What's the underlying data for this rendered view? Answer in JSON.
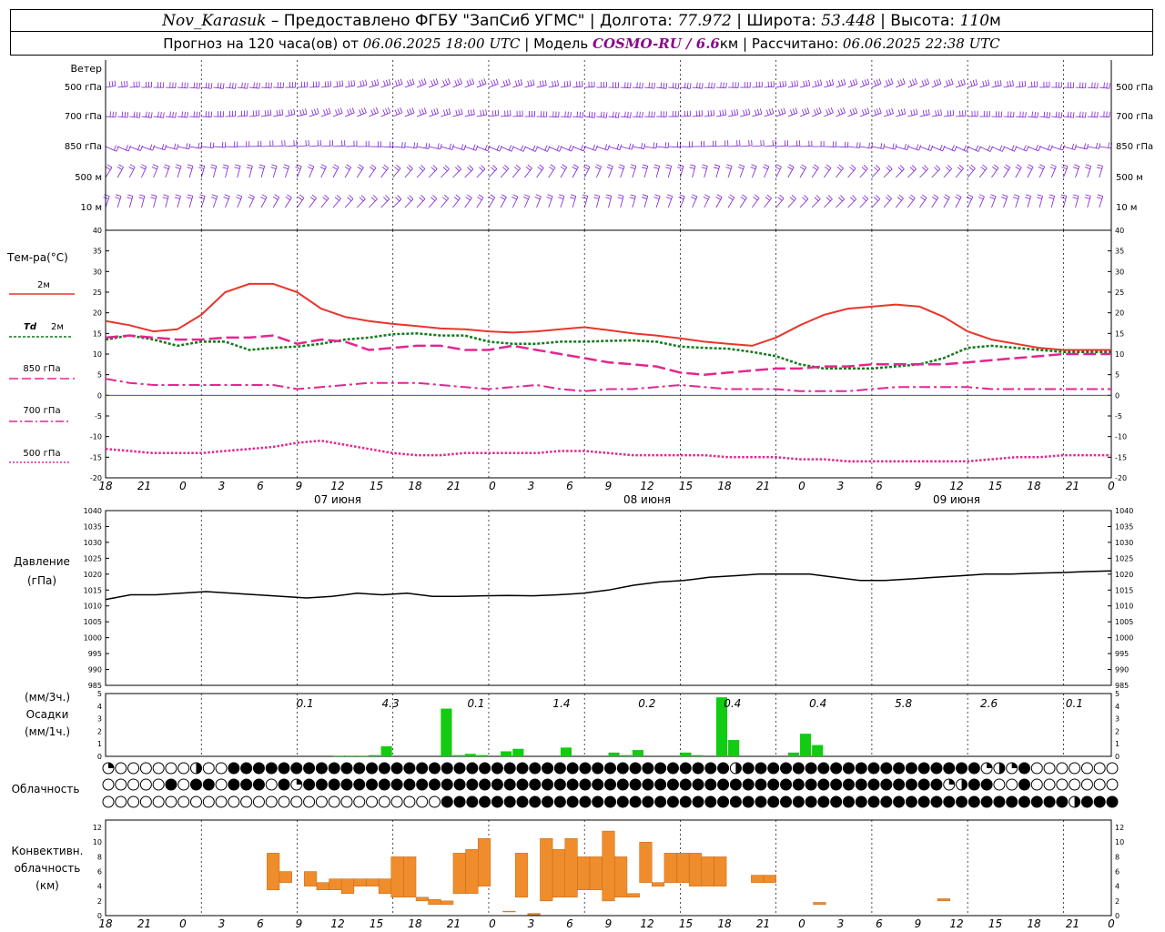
{
  "header": {
    "station": "Nov_Karasuk",
    "dash": " – ",
    "provided_by": "Предоставлено ФГБУ \"ЗапСиб УГМС\"",
    "sep": " | ",
    "lon_label": "Долгота: ",
    "lon_value": "77.972",
    "lat_label": "Широта: ",
    "lat_value": "53.448",
    "alt_label": "Высота: ",
    "alt_value": "110",
    "alt_unit": "м"
  },
  "subheader": {
    "forecast_label": "Прогноз на 120 часа(ов) от ",
    "forecast_time": "06.06.2025 18:00 UTC",
    "model_label": " | Модель ",
    "model_name": "COSMO-RU / 6.6",
    "model_unit": "км",
    "calc_label": " | Рассчитано: ",
    "calc_time": "06.06.2025 22:38 UTC"
  },
  "wind": {
    "title": "Ветер",
    "levels": [
      "500 гПа",
      "700 гПа",
      "850 гПа",
      "500 м",
      "10 м"
    ],
    "color": "#7a1fd6"
  },
  "x_axis": {
    "ticks": [
      "18",
      "21",
      "0",
      "3",
      "6",
      "9",
      "12",
      "15",
      "18",
      "21",
      "0",
      "3",
      "6",
      "9",
      "12",
      "15",
      "18",
      "21",
      "0",
      "3",
      "6",
      "9",
      "12",
      "15",
      "18",
      "21",
      "0"
    ],
    "dates": [
      "07 июня",
      "08 июня",
      "09 июня"
    ]
  },
  "legend": {
    "temp_title": "Тем-ра(°C)",
    "t2m": "2м",
    "td_symbol": "Td",
    "td_level": "2м",
    "t850": "850 гПа",
    "t700": "700 гПа",
    "t500": "500 гПа",
    "colors": {
      "t2m": "#e8352c",
      "td": "#11791b",
      "t850": "#e3268f",
      "t700": "#e3268f",
      "t500": "#e3268f"
    }
  },
  "pressure_panel": {
    "label1": "Давление",
    "label2": "(гПа)"
  },
  "precip_panel": {
    "label1": "(мм/3ч.)",
    "label2": "Осадки",
    "label3": "(мм/1ч.)",
    "bar_color": "#11cc11"
  },
  "cloud_panel": {
    "label": "Облачность"
  },
  "conv_panel": {
    "label1": "Конвективн.",
    "label2": "облачность",
    "label3": "(км)",
    "bar_color": "#ef8c2c"
  },
  "chart_data": [
    {
      "type": "line",
      "title": "Тем-ра(°C)",
      "x": [
        0,
        3,
        6,
        9,
        12,
        15,
        18,
        21,
        24,
        27,
        30,
        33,
        36,
        39,
        42,
        45,
        48,
        51,
        54,
        57,
        60,
        63,
        66,
        69,
        72,
        75,
        78,
        81,
        84,
        87,
        90,
        93,
        96,
        99,
        102,
        105,
        108,
        111,
        114,
        117,
        120,
        123,
        126
      ],
      "ylim": [
        -20,
        40
      ],
      "yticks": [
        40,
        35,
        30,
        25,
        20,
        15,
        10,
        5,
        0,
        -5,
        -10,
        -15,
        -20
      ],
      "series": [
        {
          "name": "2м",
          "values": [
            18,
            17,
            15.5,
            16,
            19.5,
            25,
            27,
            27,
            25,
            21,
            19,
            18,
            17.3,
            16.8,
            16.2,
            16,
            15.5,
            15.2,
            15.5,
            16,
            16.5,
            15.8,
            15,
            14.5,
            13.8,
            13,
            12.5,
            12,
            14,
            17,
            19.5,
            21,
            21.5,
            22,
            21.5,
            19,
            15.5,
            13.5,
            12.5,
            11.5,
            11,
            11,
            11
          ]
        },
        {
          "name": "Td 2м",
          "values": [
            13.5,
            14.5,
            13.5,
            12,
            13,
            13,
            11,
            11.5,
            11.8,
            12.5,
            13.5,
            14,
            14.8,
            15,
            14.5,
            14.5,
            13,
            12.5,
            12.5,
            13,
            13,
            13.2,
            13.3,
            13,
            11.8,
            11.5,
            11.3,
            10.5,
            9.5,
            7.5,
            6.5,
            6.5,
            6.5,
            7,
            7.5,
            9,
            11.5,
            12,
            11.5,
            11,
            10.5,
            10.5,
            10.5
          ]
        },
        {
          "name": "850 гПа",
          "values": [
            14,
            14.5,
            14,
            13.5,
            13.5,
            14,
            14,
            14.5,
            12.5,
            13.5,
            13,
            11,
            11.5,
            12,
            12,
            11,
            11,
            12,
            11,
            10,
            9,
            8,
            7.5,
            7,
            5.5,
            5,
            5.5,
            6,
            6.5,
            6.5,
            7,
            7,
            7.5,
            7.5,
            7.5,
            7.5,
            8,
            8.5,
            9,
            9.5,
            10,
            10,
            10
          ]
        },
        {
          "name": "700 гПа",
          "values": [
            4,
            3,
            2.5,
            2.5,
            2.5,
            2.5,
            2.5,
            2.5,
            1.5,
            2,
            2.5,
            3,
            3,
            3,
            2.5,
            2,
            1.5,
            2,
            2.5,
            1.5,
            1,
            1.5,
            1.5,
            2,
            2.5,
            2,
            1.5,
            1.5,
            1.5,
            1,
            1,
            1,
            1.5,
            2,
            2,
            2,
            2,
            1.5,
            1.5,
            1.5,
            1.5,
            1.5,
            1.5
          ]
        },
        {
          "name": "500 гПа",
          "values": [
            -13,
            -13.5,
            -14,
            -14,
            -14,
            -13.5,
            -13,
            -12.5,
            -11.5,
            -11,
            -12,
            -13,
            -14,
            -14.5,
            -14.5,
            -14,
            -14,
            -14,
            -14,
            -13.5,
            -13.5,
            -14,
            -14.5,
            -14.5,
            -14.5,
            -14.5,
            -15,
            -15,
            -15,
            -15.5,
            -15.5,
            -16,
            -16,
            -16,
            -16,
            -16,
            -16,
            -15.5,
            -15,
            -15,
            -14.5,
            -14.5,
            -14.5
          ]
        }
      ]
    },
    {
      "type": "line",
      "title": "Давление (гПа)",
      "ylim": [
        985,
        1040
      ],
      "yticks": [
        1040,
        1035,
        1030,
        1025,
        1020,
        1015,
        1010,
        1005,
        1000,
        995,
        990,
        985
      ],
      "series": [
        {
          "name": "Давление",
          "color": "#000000",
          "x": [
            0,
            3,
            6,
            9,
            12,
            15,
            18,
            21,
            24,
            27,
            30,
            33,
            36,
            39,
            42,
            45,
            48,
            51,
            54,
            57,
            60,
            63,
            66,
            69,
            72,
            75,
            78,
            81,
            84,
            87,
            90,
            93,
            96,
            99,
            102,
            105,
            108,
            111,
            114,
            117,
            120
          ],
          "values": [
            1012,
            1013.5,
            1013.5,
            1014,
            1014.5,
            1014,
            1013.5,
            1013,
            1012.5,
            1013,
            1014,
            1013.5,
            1014,
            1013,
            1013,
            1013.2,
            1013.3,
            1013.2,
            1013.5,
            1014,
            1015,
            1016.5,
            1017.5,
            1018,
            1019,
            1019.5,
            1020,
            1020,
            1020,
            1019,
            1018,
            1018,
            1018.5,
            1019,
            1019.5,
            1020,
            1020,
            1020.3,
            1020.5,
            1020.8,
            1021
          ]
        }
      ]
    },
    {
      "type": "bar",
      "title": "Осадки (мм/1ч.)",
      "ylim": [
        0,
        5
      ],
      "yticks": [
        5,
        4,
        3,
        2,
        1,
        0
      ],
      "three_hour_totals": {
        "x": [
          12,
          18,
          24,
          30,
          36,
          42,
          48,
          54,
          60,
          66,
          72
        ],
        "labels": [
          "0.1",
          "4.3",
          "0.1",
          "1.4",
          "0.2",
          "0.4",
          "0.4",
          "5.8",
          "2.6",
          "0.1",
          ""
        ]
      },
      "hourly": {
        "x": [
          19,
          20,
          21,
          22,
          23,
          28,
          29,
          30,
          31,
          33,
          34,
          38,
          42,
          43,
          44,
          48,
          49,
          51,
          52,
          57,
          58,
          59
        ],
        "values": [
          0.05,
          0.05,
          0.05,
          0.1,
          0.8,
          3.8,
          0.1,
          0.2,
          0.1,
          0.4,
          0.6,
          0.7,
          0.3,
          0.1,
          0.5,
          0.3,
          0.1,
          4.7,
          1.3,
          0.3,
          1.8,
          0.9
        ]
      }
    },
    {
      "type": "table",
      "title": "Облачность",
      "rows": [
        "qoooooofoohhhhhhhhhhhhhhhhhhhhhhhhhhhhhhhhhhhhhhhhfhhhhhhhhhhhhhhhhhhhqfqhooooooooooooooooooooooooooooooooooooooooo",
        "ooooohohhohhhohthhhhhhhhhhhhhhhhhhhhhhhhhhhhhhhhhhhhhhhhhhhhhhhhhhhtfhhoohooooooooooooooooooooooooooooooooooooooooo",
        "ooooooooooooooooooooooooooohhhhhhhhhhhhhhhhhhhhhhhhhhhhhhhhhhhhhhhhhhhhhhhhhhfhhhhhhhhhhhhhhhhhhhhhhhhhoooooooooooooo"
      ]
    },
    {
      "type": "bar",
      "title": "Конвективн. облачность (км)",
      "ylim": [
        0,
        13
      ],
      "yticks": [
        12,
        10,
        8,
        6,
        4,
        2,
        0
      ],
      "segments": [
        {
          "x": 13,
          "bottom": 3.5,
          "top": 8.5
        },
        {
          "x": 14,
          "bottom": 4.5,
          "top": 6
        },
        {
          "x": 16,
          "bottom": 4,
          "top": 6
        },
        {
          "x": 17,
          "bottom": 3.5,
          "top": 4.5
        },
        {
          "x": 18,
          "bottom": 3.5,
          "top": 5
        },
        {
          "x": 19,
          "bottom": 3,
          "top": 5
        },
        {
          "x": 20,
          "bottom": 4,
          "top": 5
        },
        {
          "x": 21,
          "bottom": 4,
          "top": 5
        },
        {
          "x": 22,
          "bottom": 3,
          "top": 5
        },
        {
          "x": 23,
          "bottom": 2.5,
          "top": 8
        },
        {
          "x": 24,
          "bottom": 2.5,
          "top": 8
        },
        {
          "x": 25,
          "bottom": 2,
          "top": 2.5
        },
        {
          "x": 26,
          "bottom": 1.5,
          "top": 2.2
        },
        {
          "x": 27,
          "bottom": 1.5,
          "top": 2
        },
        {
          "x": 28,
          "bottom": 3,
          "top": 8.5
        },
        {
          "x": 29,
          "bottom": 3,
          "top": 9
        },
        {
          "x": 30,
          "bottom": 4,
          "top": 10.5
        },
        {
          "x": 32,
          "bottom": 0.5,
          "top": 0.6
        },
        {
          "x": 33,
          "bottom": 2.5,
          "top": 8.5
        },
        {
          "x": 34,
          "bottom": 0.1,
          "top": 0.3
        },
        {
          "x": 35,
          "bottom": 2,
          "top": 10.5
        },
        {
          "x": 36,
          "bottom": 2.5,
          "top": 9
        },
        {
          "x": 37,
          "bottom": 2.5,
          "top": 10.5
        },
        {
          "x": 38,
          "bottom": 3.5,
          "top": 8
        },
        {
          "x": 39,
          "bottom": 3.5,
          "top": 8
        },
        {
          "x": 40,
          "bottom": 2,
          "top": 11.5
        },
        {
          "x": 41,
          "bottom": 2.5,
          "top": 8
        },
        {
          "x": 42,
          "bottom": 2.5,
          "top": 3
        },
        {
          "x": 43,
          "bottom": 4.5,
          "top": 10
        },
        {
          "x": 44,
          "bottom": 4,
          "top": 4.5
        },
        {
          "x": 45,
          "bottom": 4.5,
          "top": 8.5
        },
        {
          "x": 46,
          "bottom": 4.5,
          "top": 8.5
        },
        {
          "x": 47,
          "bottom": 4,
          "top": 8.5
        },
        {
          "x": 48,
          "bottom": 4,
          "top": 8
        },
        {
          "x": 49,
          "bottom": 4,
          "top": 8
        },
        {
          "x": 52,
          "bottom": 4.5,
          "top": 5.5
        },
        {
          "x": 53,
          "bottom": 4.5,
          "top": 5.5
        },
        {
          "x": 57,
          "bottom": 1.5,
          "top": 1.8
        },
        {
          "x": 67,
          "bottom": 2,
          "top": 2.3
        }
      ]
    }
  ]
}
